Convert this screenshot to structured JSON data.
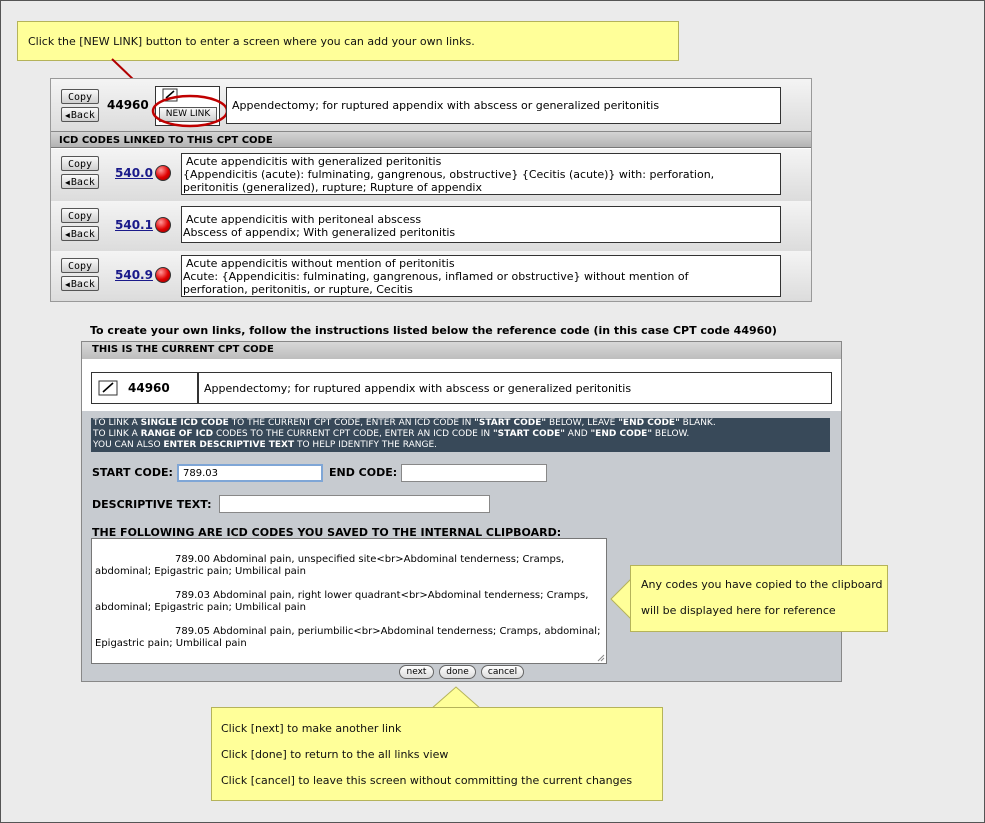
{
  "callouts": {
    "top": "Click the [NEW LINK] button to enter a screen where you can add your own links.",
    "clipboard_line1": "Any codes you have copied to the clipboard",
    "clipboard_line2": "will be displayed here for reference",
    "bottom_next": "Click [next] to make another link",
    "bottom_done": "Click [done] to return to the all links view",
    "bottom_cancel": "Click [cancel] to leave this screen without committing the current changes"
  },
  "cpt": {
    "code": "44960",
    "description": "Appendectomy; for ruptured appendix with abscess or generalized peritonitis",
    "copy_label": "Copy",
    "back_label": "Back",
    "new_link_label": "NEW LINK"
  },
  "icd_section_title": "ICD CODES LINKED TO THIS CPT CODE",
  "icd_rows": [
    {
      "code": "540.0",
      "line1": "Acute appendicitis with generalized peritonitis",
      "line2": "{Appendicitis (acute): fulminating, gangrenous, obstructive} {Cecitis (acute)} with: perforation,",
      "line3": "peritonitis (generalized), rupture; Rupture of appendix"
    },
    {
      "code": "540.1",
      "line1": "Acute appendicitis with peritoneal abscess",
      "line2": "Abscess of appendix; With generalized peritonitis",
      "line3": ""
    },
    {
      "code": "540.9",
      "line1": "Acute appendicitis without mention of peritonitis",
      "line2": "Acute: {Appendicitis: fulminating, gangrenous, inflamed or obstructive} without mention of",
      "line3": "perforation, peritonitis, or rupture, Cecitis"
    }
  ],
  "create_heading": "To create your own links, follow the instructions listed below the reference code (in this case CPT code 44960)",
  "editor": {
    "title": "THIS IS THE CURRENT CPT CODE",
    "instructions": {
      "l1_a": "TO LINK A ",
      "l1_b": "SINGLE ICD CODE",
      "l1_c": " TO THE CURRENT CPT CODE, ENTER AN ICD CODE IN ",
      "l1_d": "\"START CODE\"",
      "l1_e": " BELOW, LEAVE ",
      "l1_f": "\"END CODE\"",
      "l1_g": " BLANK.",
      "l2_a": "TO LINK A ",
      "l2_b": "RANGE OF ICD",
      "l2_c": " CODES TO THE CURRENT CPT CODE, ENTER AN ICD CODE IN ",
      "l2_d": "\"START CODE\"",
      "l2_e": " AND ",
      "l2_f": "\"END CODE\"",
      "l2_g": " BELOW.",
      "l3_a": "YOU CAN ALSO ",
      "l3_b": "ENTER DESCRIPTIVE TEXT",
      "l3_c": " TO HELP IDENTIFY THE RANGE."
    },
    "start_code_label": "START CODE:",
    "start_code_value": "789.03",
    "end_code_label": "END CODE:",
    "end_code_value": "",
    "descriptive_label": "DESCRIPTIVE TEXT:",
    "descriptive_value": "",
    "clipboard_heading": "THE FOLLOWING ARE ICD CODES YOU SAVED TO THE INTERNAL CLIPBOARD:",
    "clipboard_items": [
      "789.00 Abdominal pain, unspecified site<br>Abdominal tenderness; Cramps, abdominal; Epigastric pain; Umbilical pain",
      "789.03 Abdominal pain, right lower quadrant<br>Abdominal tenderness; Cramps, abdominal; Epigastric pain; Umbilical pain",
      "789.05 Abdominal pain, periumbilic<br>Abdominal tenderness; Cramps, abdominal; Epigastric pain; Umbilical pain"
    ],
    "next_label": "next",
    "done_label": "done",
    "cancel_label": "cancel"
  }
}
